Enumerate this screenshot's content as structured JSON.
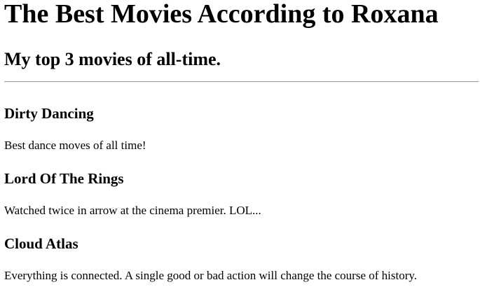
{
  "page": {
    "title": "The Best Movies According to Roxana",
    "subtitle": "My top 3 movies of all-time."
  },
  "movies": [
    {
      "title": "Dirty Dancing",
      "description": "Best dance moves of all time!"
    },
    {
      "title": "Lord Of The Rings",
      "description": "Watched twice in arrow at the cinema premier. LOL..."
    },
    {
      "title": "Cloud Atlas",
      "description": "Everything is connected. A single good or bad action will change the course of history."
    }
  ]
}
